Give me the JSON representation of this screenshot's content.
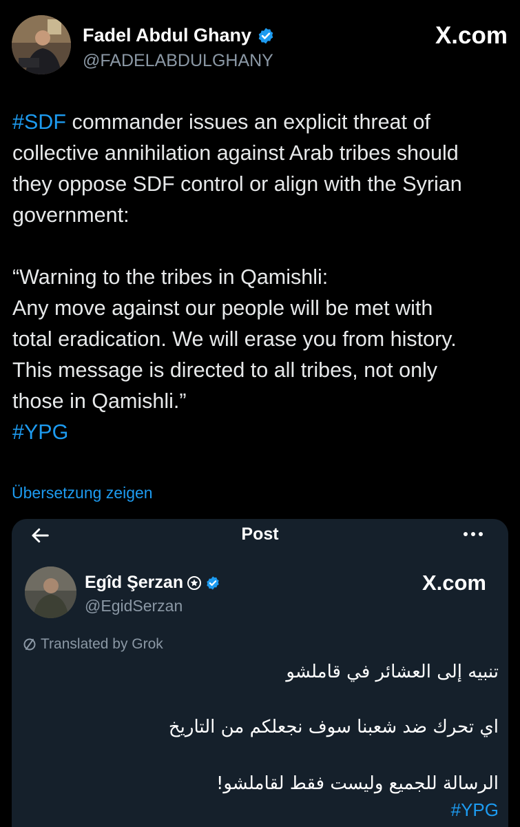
{
  "author": {
    "name": "Fadel Abdul Ghany",
    "handle": "@FADELABDULGHANY",
    "site_label": "X.com"
  },
  "post": {
    "lines": [
      {
        "hashtag": "#SDF",
        "text": " commander issues an explicit threat of"
      },
      {
        "text": "collective annihilation against Arab tribes should"
      },
      {
        "text": "they oppose SDF control or align with the Syrian"
      },
      {
        "text": "government:"
      },
      {
        "text": "“Warning to the tribes in Qamishli:"
      },
      {
        "text": "Any move against our people will be met with"
      },
      {
        "text": "total eradication. We will erase you from history."
      },
      {
        "text": "This message is directed to all tribes, not only"
      },
      {
        "text": "those in Qamishli.”"
      }
    ],
    "closing_hashtag": "#YPG",
    "translate_link": "Übersetzung zeigen"
  },
  "embedded": {
    "title": "Post",
    "author_name": "Egîd Şerzan",
    "author_handle": "@EgidSerzan",
    "site_label": "X.com",
    "translated_label": "Translated by Grok",
    "arabic_lines": [
      "تنبيه إلى العشائر في قاملشو",
      "اي تحرك ضد شعبنا سوف نجعلكم من التاريخ",
      "الرسالة للجميع وليست فقط لقاملشو!"
    ],
    "hashtag": "#YPG"
  },
  "icons": {
    "verified": "verified-badge-icon",
    "back": "back-arrow-icon",
    "more": "more-options-icon",
    "grok": "slash-circle-icon"
  },
  "colors": {
    "background": "#000000",
    "card_background": "#15202b",
    "link": "#1d9bf0",
    "secondary_text": "#8b98a5"
  }
}
